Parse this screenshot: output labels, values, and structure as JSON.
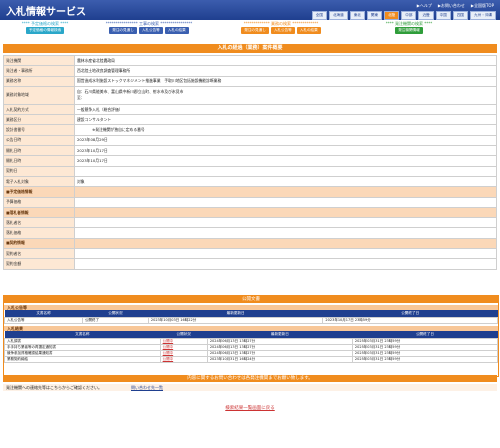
{
  "header": {
    "logo": "入札情報サービス",
    "links": [
      "▶ヘルプ",
      "▶お問い合わせ",
      "▶全国版TOP"
    ],
    "regions": [
      "全国",
      "北海道",
      "東北",
      "関東",
      "北陸",
      "中部",
      "近畿",
      "中国",
      "四国",
      "九州・沖縄"
    ],
    "active_region": "北陸"
  },
  "nav": [
    {
      "title": "**** 予定価格の検索 ****",
      "tabs": [
        "予定価格の情報検索"
      ],
      "color": "#2aa7c9"
    },
    {
      "title": "**************** 工事の検索 ****************",
      "tabs": [
        "発注の見通し",
        "入札公告等",
        "入札の結果"
      ],
      "color": "#3a5fb0"
    },
    {
      "title": "************* 業務の検索 *************",
      "tabs": [
        "発注の見通し",
        "入札公告等",
        "入札の結果"
      ],
      "color": "#f08c1e"
    },
    {
      "title": "**** 発注機関の検索 ****",
      "tabs": [
        "発注機関情報"
      ],
      "color": "#2f9d3a"
    }
  ],
  "page_title": "入札の経過（業務）案件概要",
  "detail_rows": [
    {
      "label": "発注機関",
      "value": "農林水産省北陸農政局",
      "section": false
    },
    {
      "label": "発注者・事務所",
      "value": "西北陸土地改良調査管理事務所",
      "section": false
    },
    {
      "label": "業務名称",
      "value": "国営造成水利施設ストックマネジメント推進事業　手取川地区包括施設機能診断業務",
      "section": false
    },
    {
      "label": "業務対象地域",
      "value": "自：石川県能美市、富山県中新川郡立山町、射水市及び氷見市\n至：",
      "section": false
    },
    {
      "label": "入札契約方式",
      "value": "一般競争入札（総合評価）",
      "section": false
    },
    {
      "label": "業務区分",
      "value": "建設コンサルタント",
      "section": false
    },
    {
      "label": "設計書番号",
      "value": "　　　　※発注機関が独自に定める番号",
      "section": false
    },
    {
      "label": "公告日時",
      "value": "2023年08月29日",
      "section": false
    },
    {
      "label": "開札日時",
      "value": "2023年10月17日",
      "section": false
    },
    {
      "label": "開札日時",
      "value": "2023年10月17日",
      "section": false
    },
    {
      "label": "契約日",
      "value": "",
      "section": false
    },
    {
      "label": "電子入札対象",
      "value": "対象",
      "section": false
    },
    {
      "label": "■予定価格情報",
      "value": "",
      "section": true
    },
    {
      "label": "予算価格",
      "value": "",
      "section": false
    },
    {
      "label": "■落札者情報",
      "value": "",
      "section": true
    },
    {
      "label": "落札者名",
      "value": "",
      "section": false
    },
    {
      "label": "落札価格",
      "value": "",
      "section": false
    },
    {
      "label": "■契約情報",
      "value": "",
      "section": true
    },
    {
      "label": "契約者名",
      "value": "",
      "section": false
    },
    {
      "label": "契約金額",
      "value": "",
      "section": false
    }
  ],
  "announcements": {
    "title": "公開文書",
    "columns": [
      "文書名称",
      "公開状況",
      "最新更新日",
      "公開終了日"
    ],
    "groups": [
      {
        "name": "入札公告等",
        "rows": [
          {
            "name": "入札公告等",
            "status": "公開終了",
            "updated": "2023年10月03日 16時22分",
            "end": "2023年10月17日 23時59分"
          }
        ]
      },
      {
        "name": "入札結果",
        "rows": [
          {
            "name": "入札調書",
            "status": "公開中",
            "updated": "2024年06月13日 13時27分",
            "end": "2025年03月31日 23時59分"
          },
          {
            "name": "手手持ち業者等の再選定通知書",
            "status": "公開中",
            "updated": "2024年06月13日 13時27分",
            "end": "2025年03月31日 23時59分"
          },
          {
            "name": "競争参加資格確認結果通知書",
            "status": "公開中",
            "updated": "2024年06月13日 13時27分",
            "end": "2025年03月31日 23時59分"
          },
          {
            "name": "業務契約締結",
            "status": "公開中",
            "updated": "2023年10月31日 16時24分",
            "end": "2025年03月31日 23時59分"
          }
        ]
      }
    ]
  },
  "contact": {
    "bar": "内容に関するお問い合わせは各発注機関までお願い致します。",
    "text": "発注機関への連絡先等はこちらからご確認ください。",
    "link": "問い合わせ先一覧"
  },
  "back_link": "検索結果一覧画面に戻る"
}
